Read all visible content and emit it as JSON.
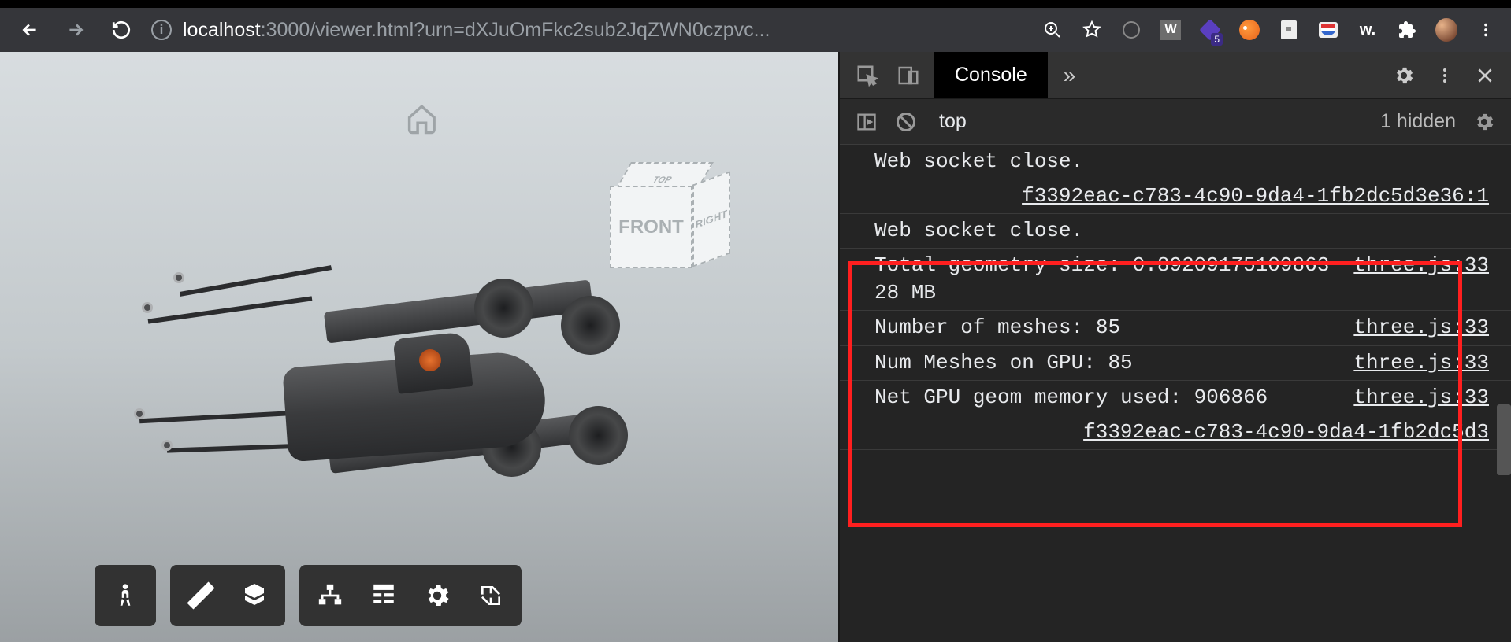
{
  "browser": {
    "url_host": "localhost",
    "url_port_path": ":3000/viewer.html?urn=dXJuOmFkc2sub2JqZWN0czpvc...",
    "extension_badge": "5"
  },
  "viewer": {
    "cube": {
      "top": "TOP",
      "front": "FRONT",
      "right": "RIGHT"
    }
  },
  "devtools": {
    "tabs": {
      "console": "Console",
      "more": "»"
    },
    "filter": {
      "context": "top",
      "hidden": "1 hidden"
    },
    "log": [
      {
        "msg": "Web socket close.",
        "src": ""
      },
      {
        "msg": "",
        "src": "f3392eac-c783-4c90-9da4-1fb2dc5d3e36:1"
      },
      {
        "msg": "Web socket close.",
        "src": ""
      },
      {
        "msg": "Total geometry size: 0.8920917510986328 MB",
        "src": "three.js:33"
      },
      {
        "msg": "Number of meshes: 85",
        "src": "three.js:33"
      },
      {
        "msg": "Num Meshes on GPU: 85",
        "src": "three.js:33"
      },
      {
        "msg": "Net GPU geom memory used: 906866",
        "src": "three.js:33"
      },
      {
        "msg": "",
        "src": "f3392eac-c783-4c90-9da4-1fb2dc5d3"
      }
    ]
  }
}
